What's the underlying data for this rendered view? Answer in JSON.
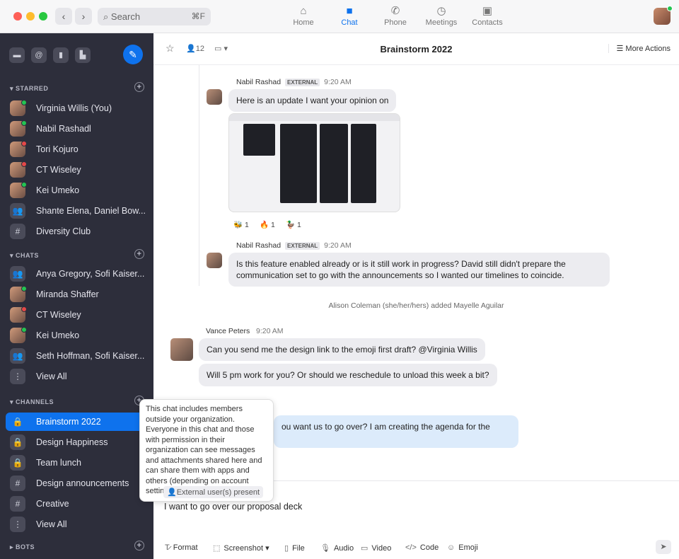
{
  "window": {
    "search_placeholder": "Search",
    "search_shortcut": "⌘F"
  },
  "nav_tabs": [
    {
      "label": "Home",
      "icon": "home-icon"
    },
    {
      "label": "Chat",
      "icon": "chat-icon",
      "active": true
    },
    {
      "label": "Phone",
      "icon": "phone-icon"
    },
    {
      "label": "Meetings",
      "icon": "clock-icon"
    },
    {
      "label": "Contacts",
      "icon": "contacts-icon"
    }
  ],
  "accent": "#0e72ed",
  "sidebar": {
    "sections": {
      "starred": "STARRED",
      "chats": "CHATS",
      "channels": "CHANNELS",
      "bots": "BOTS"
    },
    "starred": [
      {
        "label": "Virginia Willis (You)"
      },
      {
        "label": "Nabil Rashadl"
      },
      {
        "label": "Tori Kojuro"
      },
      {
        "label": "CT Wiseley"
      },
      {
        "label": "Kei Umeko"
      },
      {
        "label": "Shante Elena, Daniel Bow..."
      },
      {
        "label": "Diversity Club"
      }
    ],
    "chats": [
      {
        "label": "Anya Gregory, Sofi Kaiser..."
      },
      {
        "label": "Miranda Shaffer"
      },
      {
        "label": "CT Wiseley"
      },
      {
        "label": "Kei Umeko"
      },
      {
        "label": "Seth Hoffman, Sofi Kaiser..."
      },
      {
        "label": "View All"
      }
    ],
    "channels": [
      {
        "label": "Brainstorm 2022",
        "selected": true
      },
      {
        "label": "Design Happiness"
      },
      {
        "label": "Team lunch"
      },
      {
        "label": "Design announcements"
      },
      {
        "label": "Creative"
      },
      {
        "label": "View All"
      }
    ]
  },
  "header": {
    "title": "Brainstorm 2022",
    "members": "12",
    "more_actions": "More Actions"
  },
  "messages": {
    "m1": {
      "sender": "Nabil Rashad",
      "badge": "EXTERNAL",
      "time": "9:20 AM",
      "text": "Here is an update I want your opinion on"
    },
    "reactions": [
      {
        "emoji": "🐝",
        "count": "1"
      },
      {
        "emoji": "🔥",
        "count": "1"
      },
      {
        "emoji": "🦆",
        "count": "1"
      }
    ],
    "m2": {
      "sender": "Nabil Rashad",
      "badge": "EXTERNAL",
      "time": "9:20 AM",
      "text": "Is this feature enabled already or is it still work in progress? David still didn't prepare the communication set to go with the announcements so I wanted our timelines to coincide."
    },
    "system": "Alison Coleman (she/her/hers) added Mayelle Aguilar",
    "m3": {
      "sender": "Vance Peters",
      "time": "9:20 AM",
      "text1": "Can you send me the design link to the emoji first draft? @Virginia Willis",
      "text2": "Will 5 pm work for you? Or should we reschedule to unload this week a bit?"
    },
    "m4": {
      "text": "ou want us to go over? I am creating the agenda for the"
    }
  },
  "tooltip": "This chat includes members outside your organization. Everyone in this chat and those with permission in their organization can see messages and attachments shared here and can share them with apps and others (depending on account settings).",
  "composer": {
    "external_badge": "External user(s) present",
    "value": "I want to go over our proposal deck",
    "tools": [
      "Format",
      "Screenshot",
      "File",
      "Audio",
      "Video",
      "Code",
      "Emoji"
    ]
  }
}
